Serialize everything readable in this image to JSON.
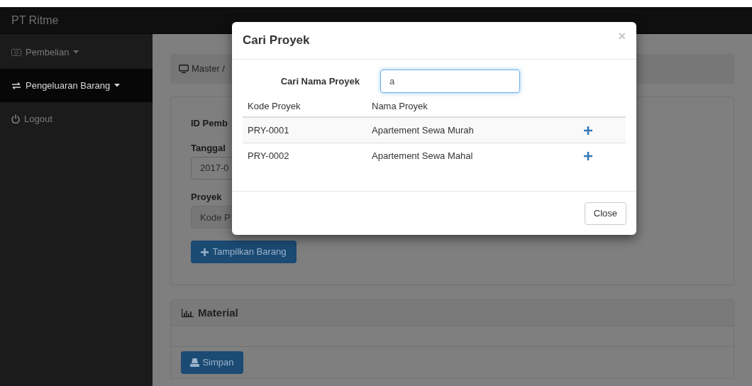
{
  "navbar": {
    "brand": "PT Ritme"
  },
  "sidebar": {
    "items": [
      {
        "label": "Pembelian",
        "dropdown": true,
        "selected": false
      },
      {
        "label": "Pengeluaran Barang",
        "dropdown": true,
        "selected": true
      },
      {
        "label": "Logout",
        "dropdown": false,
        "selected": false
      }
    ]
  },
  "breadcrumb": {
    "text": "Master /"
  },
  "form": {
    "id_label": "ID Pemb",
    "date_label": "Tanggal",
    "date_value": "2017-0",
    "project_label": "Proyek",
    "project_placeholder": "Kode P",
    "show_button": "Tampilkan Barang"
  },
  "material_panel": {
    "title": "Material",
    "save_button": "Simpan"
  },
  "modal": {
    "title": "Cari Proyek",
    "close_icon": "×",
    "search_label": "Cari Nama Proyek",
    "search_value": "a",
    "columns": [
      "Kode Proyek",
      "Nama Proyek"
    ],
    "rows": [
      {
        "code": "PRY-0001",
        "name": "Apartement Sewa Murah",
        "highlighted": true
      },
      {
        "code": "PRY-0002",
        "name": "Apartement Sewa Mahal",
        "highlighted": false
      }
    ],
    "close_button": "Close"
  }
}
